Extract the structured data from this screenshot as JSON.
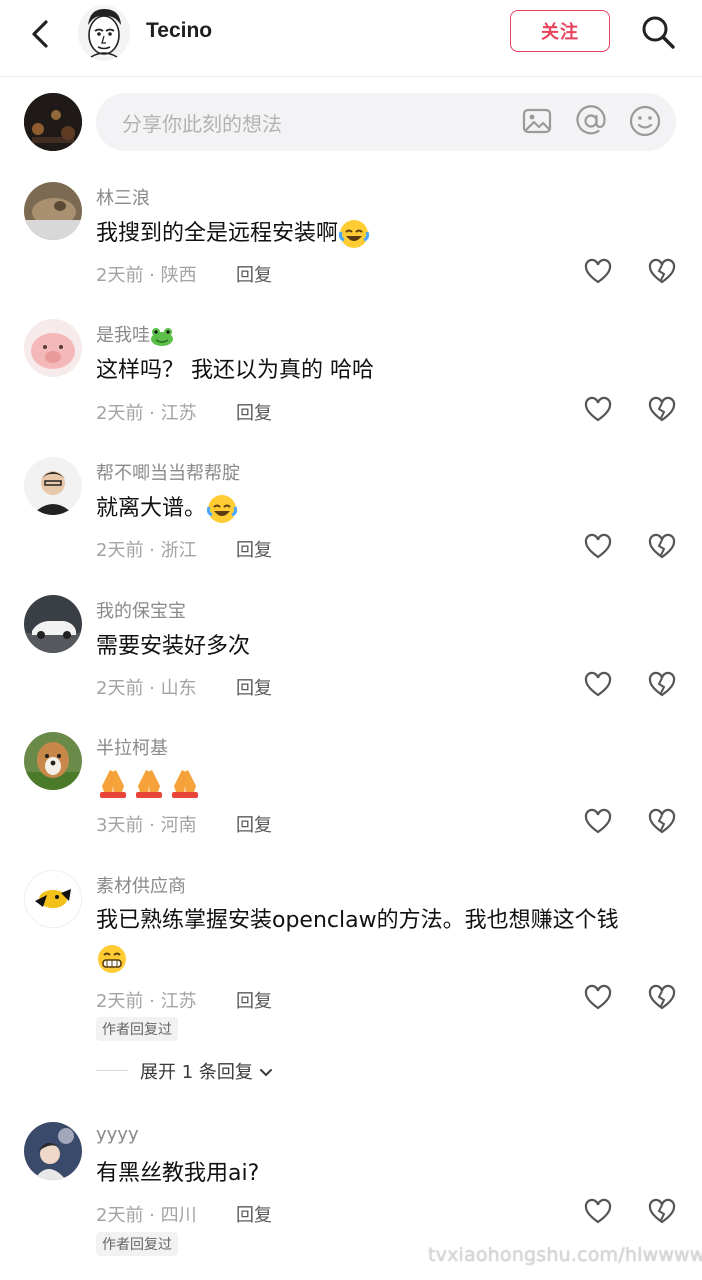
{
  "header": {
    "author_name": "Tecino",
    "follow_label": "关注",
    "back_icon": "chevron-left-icon",
    "search_icon": "search-icon"
  },
  "comment_input": {
    "placeholder": "分享你此刻的想法",
    "icons": [
      "image-icon",
      "at-icon",
      "emoji-icon"
    ]
  },
  "comments": [
    {
      "name": "林三浪",
      "text": "我搜到的全是远程安装啊",
      "emoji": "laughing-tears-emoji",
      "meta": "2天前 · 陕西",
      "reply": "回复"
    },
    {
      "name": "是我哇",
      "name_emoji": "frog-emoji",
      "text": "这样吗？ 我还以为真的 哈哈",
      "meta": "2天前 · 江苏",
      "reply": "回复"
    },
    {
      "name": "帮不唧当当帮帮腚",
      "text": "就离大谱。",
      "emoji": "laughing-tears-emoji",
      "meta": "2天前 · 浙江",
      "reply": "回复"
    },
    {
      "name": "我的保宝宝",
      "text": "需要安装好多次",
      "meta": "2天前 · 山东",
      "reply": "回复"
    },
    {
      "name": "半拉柯基",
      "text": "",
      "emoji": "pray-hands-emoji x3",
      "meta": "3天前 · 河南",
      "reply": "回复"
    },
    {
      "name": "素材供应商",
      "text": "我已熟练掌握安装openclaw的方法。我也想赚这个钱",
      "emoji": "grinning-emoji",
      "meta": "2天前 · 江苏",
      "reply": "回复",
      "badge": "作者回复过",
      "expand": "展开 1 条回复"
    },
    {
      "name": "yyyy",
      "text": "有黑丝教我用ai?",
      "meta": "2天前 · 四川",
      "reply": "回复",
      "badge": "作者回复过"
    }
  ],
  "watermark": "tvxiaohongshu.com/hlwwwww",
  "colors": {
    "accent": "#e8435c",
    "text": "#111111",
    "muted": "#8a8a8a",
    "input_bg": "#f3f3f5"
  }
}
